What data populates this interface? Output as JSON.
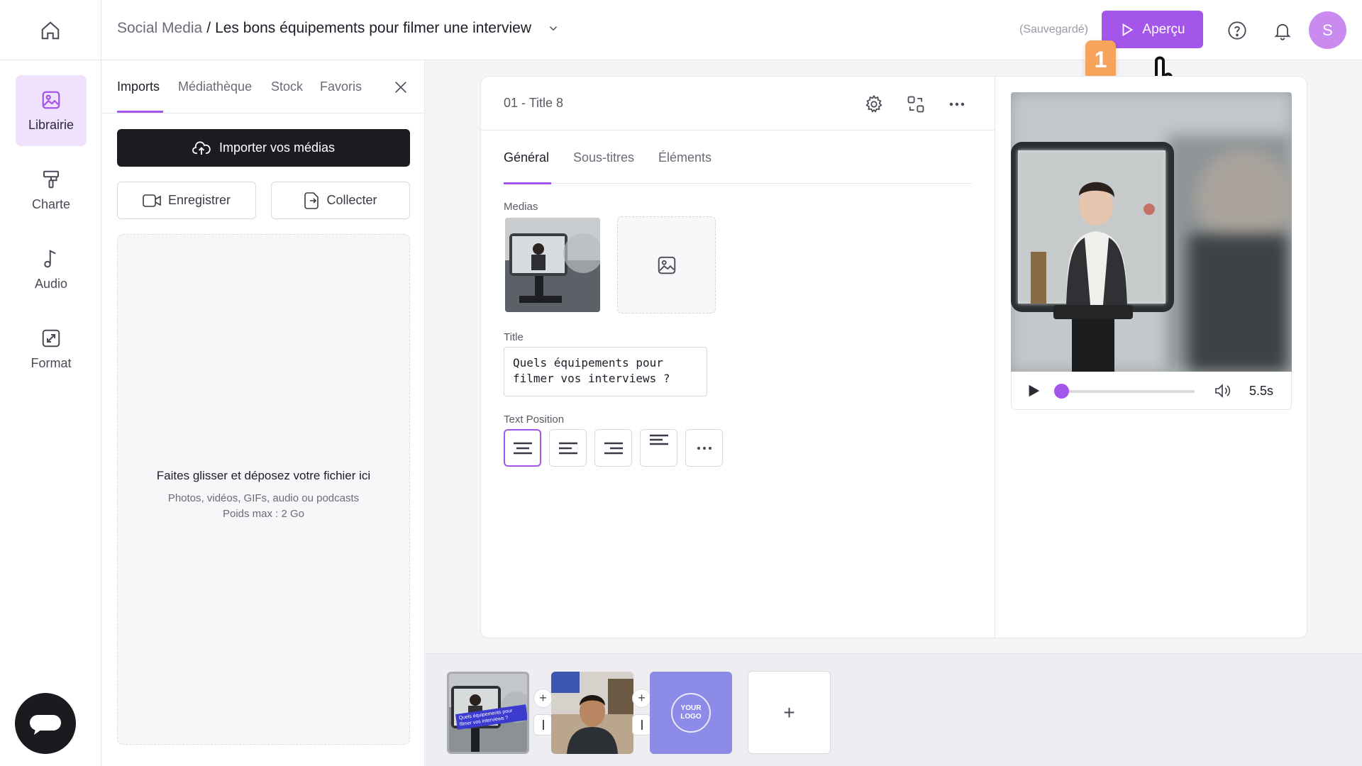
{
  "header": {
    "breadcrumb_parent": "Social Media",
    "breadcrumb_sep": "/",
    "breadcrumb_current": "Les bons équipements pour filmer une interview",
    "save_status": "(Sauvegardé)",
    "preview_label": "Aperçu",
    "avatar_initial": "S",
    "step_badge": "1",
    "accent_color": "#a455ea"
  },
  "rail": {
    "items": [
      {
        "label": "Librairie",
        "icon": "image-icon",
        "active": true
      },
      {
        "label": "Charte",
        "icon": "paint-roller-icon"
      },
      {
        "label": "Audio",
        "icon": "music-note-icon"
      },
      {
        "label": "Format",
        "icon": "resize-icon"
      }
    ]
  },
  "library": {
    "tabs": [
      "Imports",
      "Médiathèque",
      "Stock",
      "Favoris"
    ],
    "active_tab": "Imports",
    "import_label": "Importer vos médias",
    "record_label": "Enregistrer",
    "collect_label": "Collecter",
    "dropzone_title": "Faites glisser et déposez votre fichier ici",
    "dropzone_types": "Photos, vidéos, GIFs, audio ou podcasts",
    "dropzone_max": "Poids max : 2 Go"
  },
  "editor": {
    "scene_title": "01 - Title 8",
    "tabs": [
      "Général",
      "Sous-titres",
      "Éléments"
    ],
    "active_tab": "Général",
    "medias_label": "Medias",
    "title_label": "Title",
    "title_value": "Quels équipements pour\nfilmer vos interviews ?",
    "text_position_label": "Text Position"
  },
  "player": {
    "duration": "5.5s",
    "progress": 0.0
  },
  "timeline": {
    "scene1_caption": "Quels équipements pour filmer vos interviews ?",
    "logo_text": "YOUR LOGO",
    "add_label": "+"
  }
}
